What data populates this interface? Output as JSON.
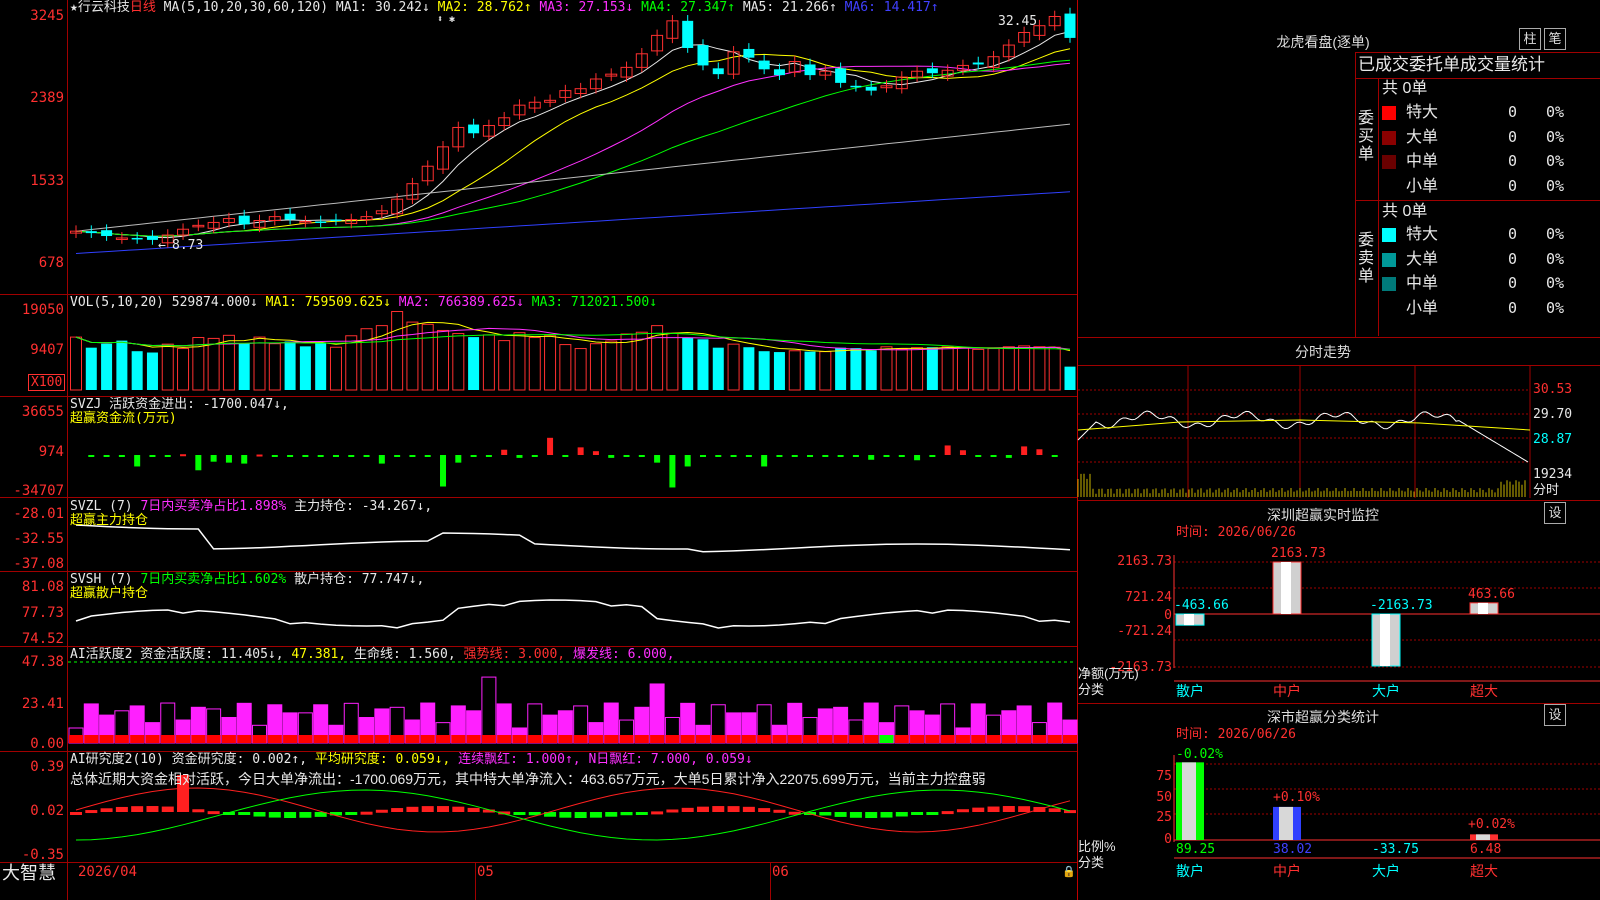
{
  "main": {
    "title_star": "★行云科技",
    "title_period": "日线",
    "ma_header": "MA(5,10,20,30,60,120)",
    "ma": [
      {
        "text": "MA1: 30.242↓",
        "color": "#e8e8e8"
      },
      {
        "text": "MA2: 28.762↑",
        "color": "#ffff00"
      },
      {
        "text": "MA3: 27.153↓",
        "color": "#ff30ff"
      },
      {
        "text": "MA4: 27.347↑",
        "color": "#00ff00"
      },
      {
        "text": "MA5: 21.266↑",
        "color": "#e8e8e8"
      },
      {
        "text": "MA6: 14.417↑",
        "color": "#4040ff"
      }
    ],
    "y_labels": [
      "3245",
      "2389",
      "1533",
      "678"
    ],
    "high_label": "32.45",
    "low_label": "8.73"
  },
  "vol": {
    "header": "VOL(5,10,20)",
    "value": "529874.000↓",
    "ma": [
      {
        "text": "MA1: 759509.625↓",
        "color": "#ffff00"
      },
      {
        "text": "MA2: 766389.625↓",
        "color": "#ff30ff"
      },
      {
        "text": "MA3: 712021.500↓",
        "color": "#00ff00"
      }
    ],
    "y_labels": [
      "19050",
      "9407"
    ],
    "unit": "X100"
  },
  "svzj": {
    "header": "SVZJ  活跃资金进出: -1700.047↓,",
    "sub": "超赢资金流(万元)",
    "y_labels": [
      "36655",
      "974",
      "-34707"
    ]
  },
  "svzl": {
    "name": "SVZL (7)",
    "pct": "7日内买卖净占比1.898%",
    "hold": "主力持仓: -34.267↓,",
    "sub": "超赢主力持仓",
    "y_labels": [
      "-28.01",
      "-32.55",
      "-37.08"
    ]
  },
  "svsh": {
    "name": "SVSH (7)",
    "pct": "7日内买卖净占比1.602%",
    "hold": "散户持仓: 77.747↓,",
    "sub": "超赢散户持仓",
    "y_labels": [
      "81.08",
      "77.73",
      "74.52"
    ]
  },
  "ai1": {
    "header": "AI活跃度2 资金活跃度: 11.405↓,",
    "v2": "47.381,",
    "life": "生命线: 1.560,",
    "strong": "强势线: 3.000,",
    "burst": "爆发线: 6.000,",
    "y_labels": [
      "47.38",
      "23.41",
      "0.00"
    ]
  },
  "ai2": {
    "header": "AI研究度2(10) 资金研究度: 0.002↑,",
    "avg": "平均研究度: 0.059↓,",
    "red": "连续飘红: 1.000↑,",
    "nred": "N日飘红: 7.000,",
    "last": "0.059↓",
    "summary": "总体近期大资金相对活跃，今日大单净流出：-1700.069万元，其中特大单净流入：463.657万元，大单5日累计净入22075.699万元，当前主力控盘弱",
    "y_labels": [
      "0.39",
      "0.02",
      "-0.35"
    ]
  },
  "bottom": {
    "brand": "大智慧",
    "date": "2026/04",
    "months": [
      "05",
      "06"
    ]
  },
  "right": {
    "lhb_title": "龙虎看盘(逐单)",
    "btn_zhu": "柱",
    "btn_bi": "笔",
    "table_title": "已成交委托单成交量统计",
    "buy_label": "委买单",
    "sell_label": "委卖单",
    "buy_total": "共 0单",
    "sell_total": "共 0单",
    "buy_rows": [
      {
        "name": "特大",
        "qty": "0",
        "pct": "0%",
        "color": "#ff0000"
      },
      {
        "name": "大单",
        "qty": "0",
        "pct": "0%",
        "color": "#8b0000"
      },
      {
        "name": "中单",
        "qty": "0",
        "pct": "0%",
        "color": "#6a0000"
      },
      {
        "name": "小单",
        "qty": "0",
        "pct": "0%",
        "color": ""
      }
    ],
    "sell_rows": [
      {
        "name": "特大",
        "qty": "0",
        "pct": "0%",
        "color": "#00ffff"
      },
      {
        "name": "大单",
        "qty": "0",
        "pct": "0%",
        "color": "#009999"
      },
      {
        "name": "中单",
        "qty": "0",
        "pct": "0%",
        "color": "#007a7a"
      },
      {
        "name": "小单",
        "qty": "0",
        "pct": "0%",
        "color": ""
      }
    ],
    "intraday_title": "分时走势",
    "intraday_labels": [
      "30.53",
      "29.70",
      "28.87",
      "19234",
      "分时"
    ],
    "sz_monitor": {
      "title": "深圳超赢实时监控",
      "set": "设",
      "time": "时间: 2026/06/26",
      "y_labels": [
        "2163.73",
        "721.24",
        "0",
        "-721.24",
        "-2163.73"
      ],
      "net_label": "净额(万元)",
      "cat_label": "分类",
      "values": [
        "-463.66",
        "2163.73",
        "-2163.73",
        "463.66"
      ],
      "categories": [
        "散户",
        "中户",
        "大户",
        "超大"
      ]
    },
    "sz_stats": {
      "title": "深市超赢分类统计",
      "set": "设",
      "time": "时间: 2026/06/26",
      "y_labels": [
        "75",
        "50",
        "25",
        "0"
      ],
      "ratio_label": "比例%",
      "cat_label": "分类",
      "top_labels": [
        "-0.02%",
        "+0.10%",
        "+0.02%"
      ],
      "values": [
        "89.25",
        "38.02",
        "-33.75",
        "6.48"
      ],
      "categories": [
        "散户",
        "中户",
        "大户",
        "超大"
      ]
    }
  },
  "chart_data": {
    "type": "candlestick",
    "title": "行云科技 日线",
    "candles_close": [
      10.3,
      10.1,
      9.8,
      9.6,
      9.5,
      9.4,
      9.9,
      10.5,
      10.9,
      11.2,
      11.6,
      11.0,
      11.4,
      11.8,
      11.5,
      11.3,
      11.2,
      11.4,
      11.5,
      11.8,
      12.4,
      13.6,
      15.2,
      17.0,
      19.0,
      21.0,
      20.4,
      21.2,
      22.0,
      23.3,
      23.6,
      23.8,
      24.8,
      25.0,
      26.0,
      26.5,
      27.2,
      28.6,
      30.5,
      32.0,
      29.2,
      27.4,
      26.5,
      28.8,
      28.2,
      27.0,
      26.4,
      27.8,
      26.4,
      26.8,
      25.6,
      25.2,
      24.8,
      25.3,
      26.2,
      26.8,
      26.6,
      26.9,
      27.4,
      27.5,
      28.3,
      29.5,
      30.8,
      31.5,
      32.45,
      30.24
    ],
    "ma": {
      "MA1": 30.242,
      "MA2": 28.762,
      "MA3": 27.153,
      "MA4": 27.347,
      "MA5": 21.266,
      "MA6": 14.417
    },
    "vol_x100": [
      12000,
      9600,
      10500,
      11200,
      8800,
      8500,
      10400,
      9400,
      11900,
      11700,
      12400,
      10600,
      12000,
      10500,
      11000,
      9900,
      10700,
      9700,
      12300,
      13900,
      14600,
      17800,
      15400,
      14900,
      13500,
      12800,
      12000,
      12500,
      11200,
      13000,
      11900,
      12300,
      10300,
      9400,
      10500,
      11100,
      12700,
      13100,
      14600,
      12900,
      11900,
      11500,
      9600,
      10400,
      9700,
      8800,
      8600,
      8900,
      8700,
      8700,
      9600,
      9500,
      9000,
      9800,
      9300,
      9600,
      9700,
      9800,
      9600,
      9200,
      9400,
      9800,
      10000,
      9800,
      9700,
      5299
    ],
    "svzj": [
      -200,
      -300,
      -200,
      -12000,
      -500,
      -600,
      800,
      -16000,
      -7000,
      -8000,
      -9000,
      500,
      -1000,
      -700,
      -300,
      -400,
      -400,
      -600,
      -800,
      -9000,
      -2000,
      -1200,
      -1200,
      -33000,
      -8000,
      -2000,
      -1000,
      5500,
      -3000,
      -1500,
      18000,
      -2000,
      8000,
      4000,
      -3000,
      -1500,
      -500,
      -8000,
      -34000,
      -12000,
      -1000,
      -700,
      -1500,
      -1000,
      -12000,
      -1500,
      -700,
      -1500,
      -1500,
      -1500,
      -800,
      -5000,
      -1000,
      -800,
      -5500,
      -500,
      10000,
      5000,
      -600,
      -800,
      -3000,
      9000,
      6000,
      -1700
    ]
  }
}
